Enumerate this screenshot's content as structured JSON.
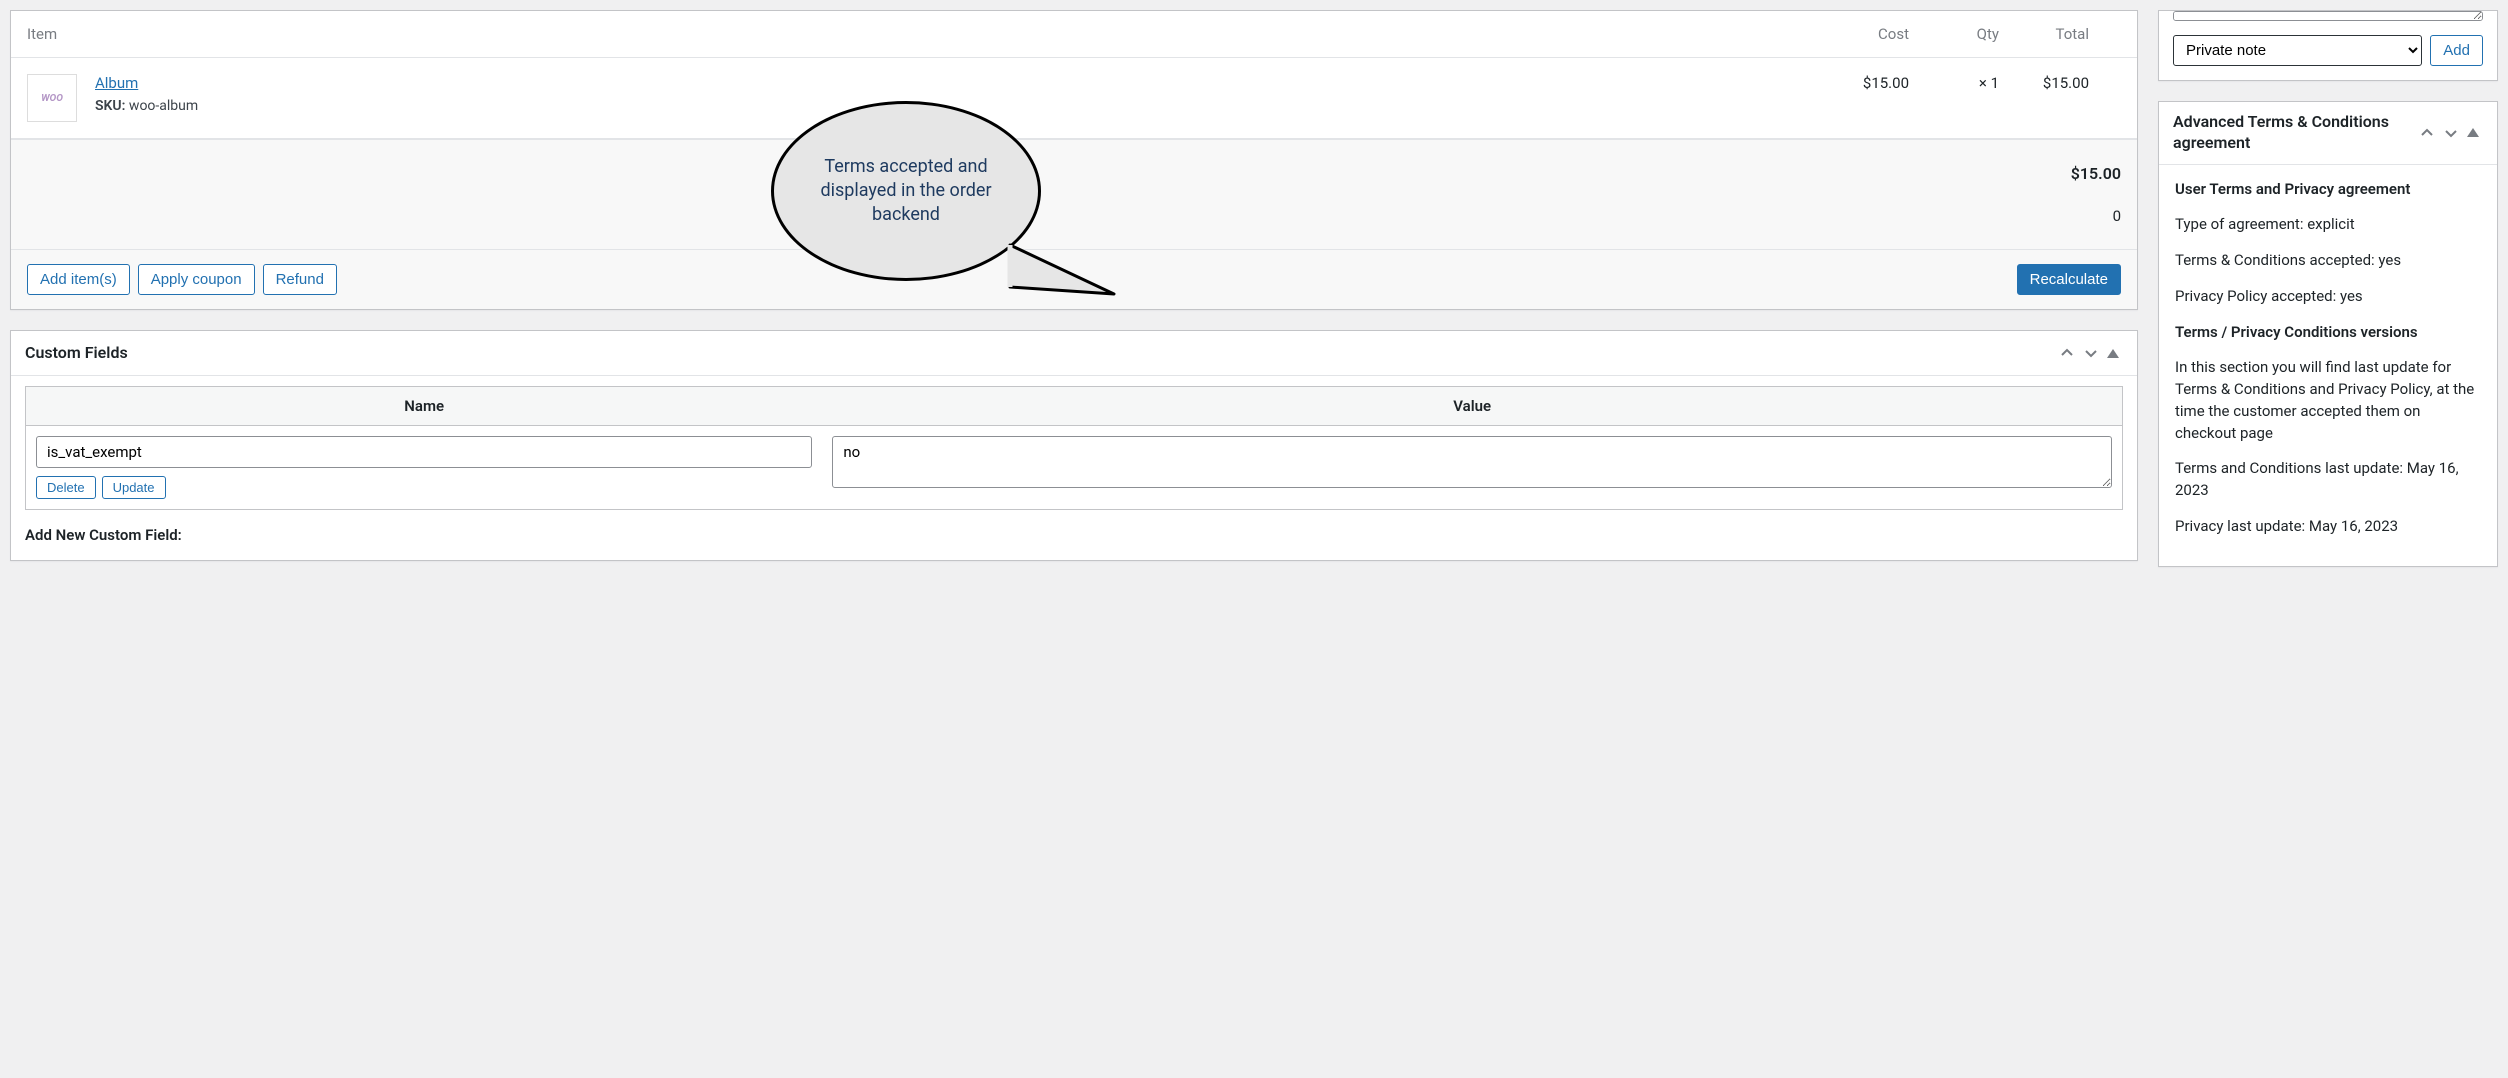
{
  "order_items": {
    "headers": {
      "item": "Item",
      "cost": "Cost",
      "qty": "Qty",
      "total": "Total"
    },
    "rows": [
      {
        "thumb_text": "WOO",
        "name": "Album",
        "sku_label": "SKU:",
        "sku": "woo-album",
        "cost": "$15.00",
        "qty": "× 1",
        "total": "$15.00"
      }
    ],
    "grand_total": "$15.00",
    "hidden_total": "0"
  },
  "actions": {
    "add_items": "Add item(s)",
    "apply_coupon": "Apply coupon",
    "refund": "Refund",
    "recalculate": "Recalculate"
  },
  "custom_fields": {
    "title": "Custom Fields",
    "headers": {
      "name": "Name",
      "value": "Value"
    },
    "rows": [
      {
        "name": "is_vat_exempt",
        "value": "no"
      }
    ],
    "row_buttons": {
      "delete": "Delete",
      "update": "Update"
    },
    "add_new_label": "Add New Custom Field:"
  },
  "notes": {
    "type_options": [
      "Private note"
    ],
    "selected": "Private note",
    "add_label": "Add"
  },
  "terms_panel": {
    "title": "Advanced Terms & Conditions agreement",
    "h1": "User Terms and Privacy agreement",
    "type_line": "Type of agreement: explicit",
    "tc_line": "Terms & Conditions accepted: yes",
    "pp_line": "Privacy Policy accepted: yes",
    "h2": "Terms / Privacy Conditions versions",
    "desc": "In this section you will find last update for Terms & Conditions and Privacy Policy, at the time the customer accepted them on checkout page",
    "tc_update": "Terms and Conditions last update: May 16, 2023",
    "pp_update": "Privacy last update: May 16, 2023"
  },
  "callout": {
    "text": "Terms accepted and displayed in the order backend"
  }
}
